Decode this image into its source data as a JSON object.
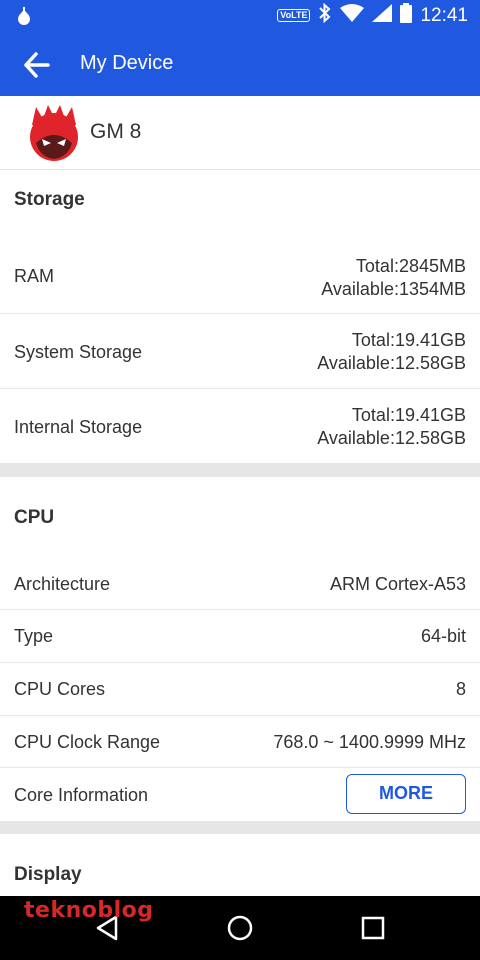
{
  "status_bar": {
    "time": "12:41",
    "volte_label": "VoLTE"
  },
  "app_bar": {
    "title": "My Device"
  },
  "device": {
    "name": "GM 8"
  },
  "storage": {
    "title": "Storage",
    "rows": [
      {
        "label": "RAM",
        "line1": "Total:2845MB",
        "line2": "Available:1354MB"
      },
      {
        "label": "System Storage",
        "line1": "Total:19.41GB",
        "line2": "Available:12.58GB"
      },
      {
        "label": "Internal Storage",
        "line1": "Total:19.41GB",
        "line2": "Available:12.58GB"
      }
    ]
  },
  "cpu": {
    "title": "CPU",
    "rows": [
      {
        "label": "Architecture",
        "value": "ARM Cortex-A53"
      },
      {
        "label": "Type",
        "value": "64-bit"
      },
      {
        "label": "CPU Cores",
        "value": "8"
      },
      {
        "label": "CPU Clock Range",
        "value": "768.0 ~ 1400.9999 MHz"
      },
      {
        "label": "Core Information",
        "button": "MORE"
      }
    ]
  },
  "display": {
    "title": "Display"
  },
  "watermark": "teknoblog",
  "colors": {
    "accent": "#2059e0",
    "watermark": "#d62828"
  }
}
